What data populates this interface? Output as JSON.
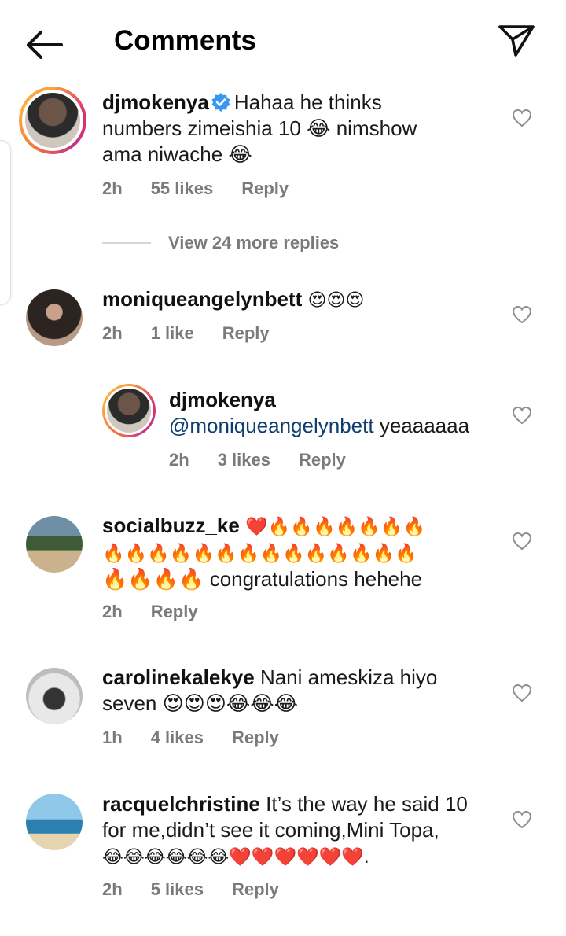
{
  "header": {
    "title": "Comments",
    "back_icon": "arrow-left-icon",
    "share_icon": "paper-plane-icon"
  },
  "comments": [
    {
      "username": "djmokenya",
      "verified": true,
      "text_lines": [
        "Hahaa he thinks",
        "numbers zimeishia 10 😂 nimshow",
        "ama niwache 😂"
      ],
      "time": "2h",
      "likes": "55 likes",
      "reply": "Reply"
    },
    {
      "view_more": "View 24 more replies"
    },
    {
      "username": "moniqueangelynbett",
      "text_lines": [
        "😍😍😍"
      ],
      "time": "2h",
      "likes": "1 like",
      "reply": "Reply"
    },
    {
      "username": "djmokenya",
      "mention": "@moniqueangelynbett",
      "text": "yeaaaaaa",
      "time": "2h",
      "likes": "3 likes",
      "reply": "Reply"
    },
    {
      "username": "socialbuzz_ke",
      "text_lines": [
        "❤️🔥🔥🔥🔥🔥🔥🔥",
        "🔥🔥🔥🔥🔥🔥🔥🔥🔥🔥🔥🔥🔥🔥",
        "🔥🔥🔥🔥 congratulations hehehe"
      ],
      "time": "2h",
      "reply": "Reply"
    },
    {
      "username": "carolinekalekye",
      "text_lines": [
        "Nani ameskiza hiyo",
        "seven 😍😍😍😂😂😂"
      ],
      "time": "1h",
      "likes": "4 likes",
      "reply": "Reply"
    },
    {
      "username": "racquelchristine",
      "text_lines": [
        "It’s the way he said 10",
        "for me,didn’t see it coming,Mini Topa,",
        "😂😂😂😂😂😂❤️❤️❤️❤️❤️❤️."
      ],
      "time": "2h",
      "likes": "5 likes",
      "reply": "Reply"
    }
  ],
  "colors": {
    "meta_gray": "#7a7a7a",
    "mention_blue": "#0f3d6e",
    "verified_blue": "#3897f0",
    "heart_outline": "#8e8e8e"
  }
}
